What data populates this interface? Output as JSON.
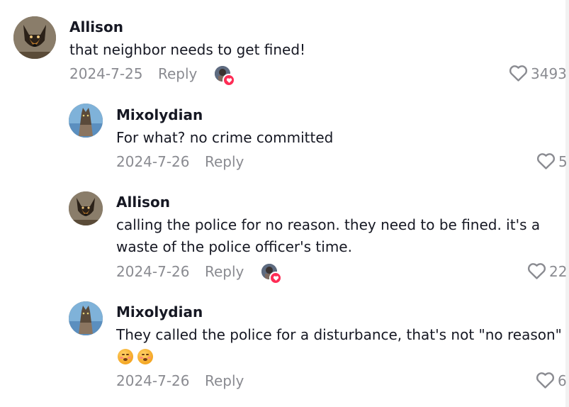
{
  "comments": [
    {
      "username": "Allison",
      "text": [
        "that neighbor needs to get fined!"
      ],
      "date": "2024-7-25",
      "reply_label": "Reply",
      "likes": "3493",
      "creator_liked": true,
      "avatar": "dog-avatar"
    },
    {
      "username": "Mixolydian",
      "text": [
        "For what? no crime committed"
      ],
      "date": "2024-7-26",
      "reply_label": "Reply",
      "likes": "5",
      "creator_liked": false,
      "avatar": "cat-avatar"
    },
    {
      "username": "Allison",
      "text": [
        "calling the police for no reason. they need to be fined. it's a",
        "waste of the police officer's time."
      ],
      "date": "2024-7-26",
      "reply_label": "Reply",
      "likes": "22",
      "creator_liked": true,
      "avatar": "dog-avatar"
    },
    {
      "username": "Mixolydian",
      "text": [
        "They called the police for a disturbance, that's not \"no reason\""
      ],
      "emojis": [
        "kissing-face-emoji",
        "kissing-face-emoji"
      ],
      "date": "2024-7-26",
      "reply_label": "Reply",
      "likes": "6",
      "creator_liked": false,
      "avatar": "cat-avatar"
    }
  ],
  "colors": {
    "text": "#161823",
    "muted": "#8a8b91",
    "heart_badge": "#fe2c55"
  }
}
